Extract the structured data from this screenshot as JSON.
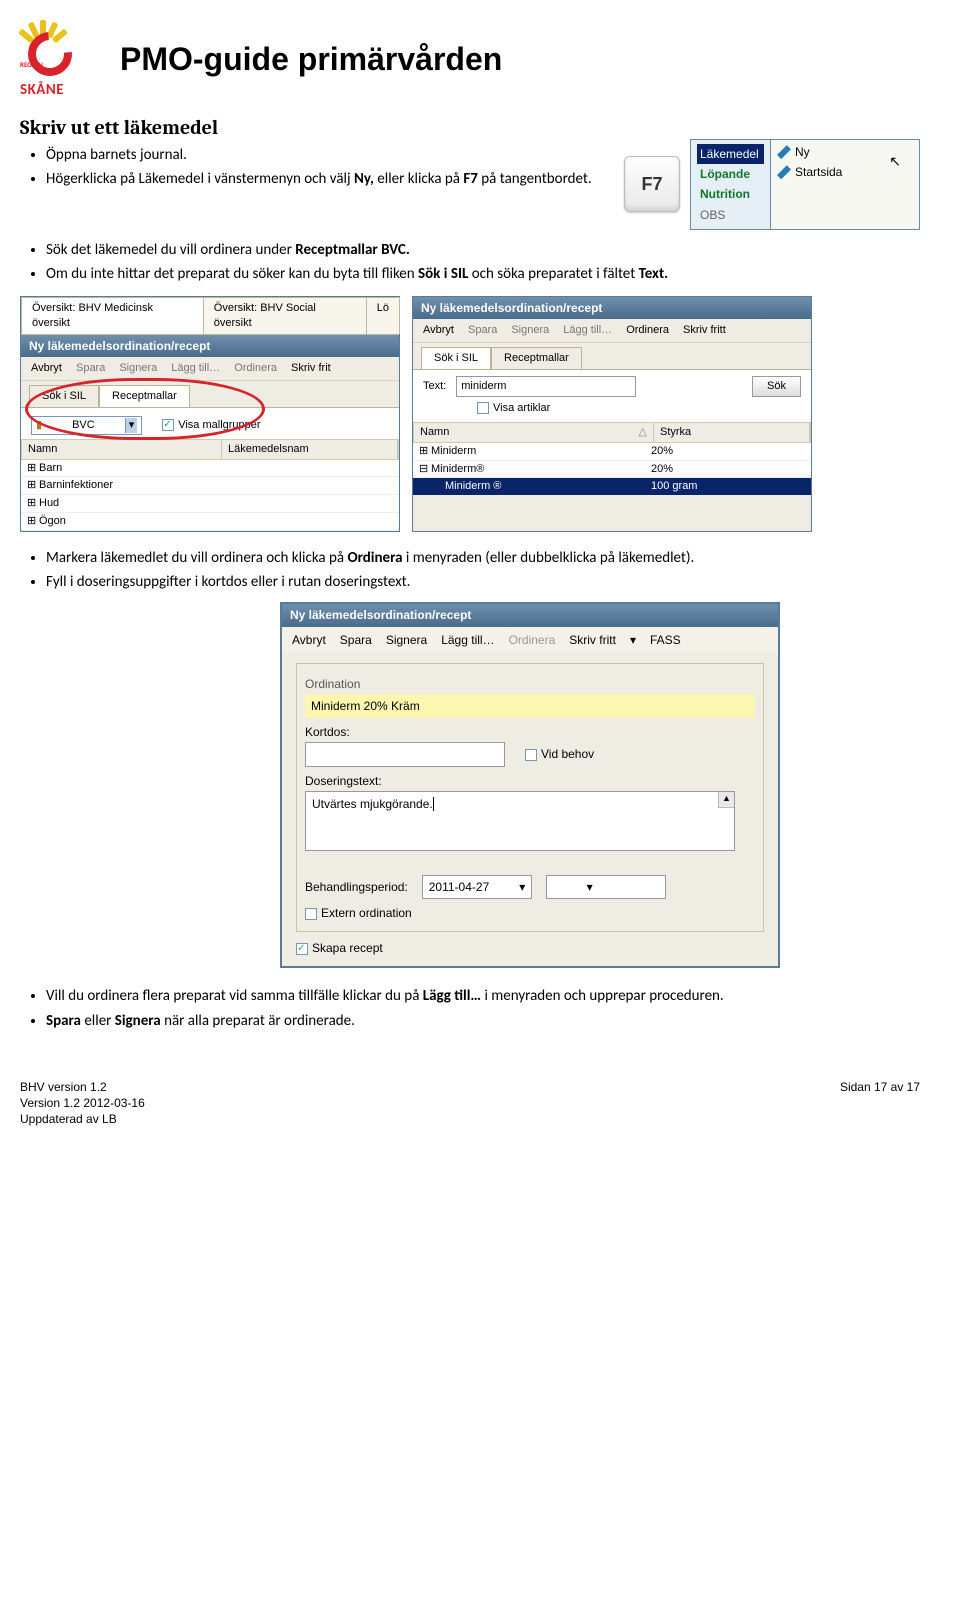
{
  "header": {
    "logo_region": "REGION",
    "logo_text": "SKÅNE",
    "page_title": "PMO-guide primärvården"
  },
  "section_title": "Skriv ut ett läkemedel",
  "bullets1": {
    "b1": "Öppna barnets journal.",
    "b2_a": "Högerklicka på Läkemedel i vänstermenyn och välj ",
    "b2_ny": "Ny, ",
    "b2_b": "eller klicka på ",
    "b2_f7": "F7",
    "b2_c": " på tangentbordet."
  },
  "context_menu": {
    "left": {
      "i1": "Läkemedel",
      "i2": "Löpande",
      "i3": "Nutrition",
      "i4": "OBS"
    },
    "right": {
      "r1": "Ny",
      "r2": "Startsida"
    }
  },
  "keycap": "F7",
  "bullets2": {
    "b1_a": "Sök det läkemedel du vill ordinera under ",
    "b1_b": "Receptmallar BVC.",
    "b2_a": "Om du inte hittar det preparat du söker kan du byta till fliken ",
    "b2_b": "Sök i SIL",
    "b2_c": " och söka preparatet i fältet ",
    "b2_d": "Text."
  },
  "shot1": {
    "tab1": "Översikt: BHV Medicinsk översikt",
    "tab2": "Översikt: BHV Social översikt",
    "tab3": "Lö",
    "bluetab": "Ny läkemedelsordination/recept",
    "tb": {
      "avbryt": "Avbryt",
      "spara": "Spara",
      "signera": "Signera",
      "lagg": "Lägg till…",
      "ordinera": "Ordinera",
      "skriv": "Skriv frit"
    },
    "sub": {
      "s1": "Sök i SIL",
      "s2": "Receptmallar"
    },
    "dropdown": {
      "icon": "folder",
      "val": "BVC"
    },
    "visa": "Visa mallgrupper",
    "cols": {
      "c1": "Namn",
      "c2": "Läkemedelsnam"
    },
    "rows": {
      "r1": "Barn",
      "r2": "Barninfektioner",
      "r3": "Hud",
      "r4": "Ögon"
    }
  },
  "shot2": {
    "title": "Ny läkemedelsordination/recept",
    "tb": {
      "avbryt": "Avbryt",
      "spara": "Spara",
      "signera": "Signera",
      "lagg": "Lägg till…",
      "ordinera": "Ordinera",
      "skriv": "Skriv fritt"
    },
    "sub": {
      "s1": "Sök i SIL",
      "s2": "Receptmallar"
    },
    "textlbl": "Text:",
    "textval": "miniderm",
    "sok": "Sök",
    "visa": "Visa artiklar",
    "cols": {
      "c1": "Namn",
      "c2": "Styrka"
    },
    "rows": {
      "r1n": "Miniderm",
      "r1s": "20%",
      "r2n": "Miniderm®",
      "r2s": "20%",
      "r3n": "Miniderm ®",
      "r3s": "100 gram"
    }
  },
  "bullets3": {
    "b1_a": "Markera läkemedlet du vill ordinera och klicka på ",
    "b1_b": "Ordinera",
    "b1_c": " i menyraden (eller dubbelklicka på läkemedlet).",
    "b2": "Fyll i doseringsuppgifter i kortdos eller i rutan doseringstext."
  },
  "shot3": {
    "title": "Ny läkemedelsordination/recept",
    "tb": {
      "avbryt": "Avbryt",
      "spara": "Spara",
      "signera": "Signera",
      "lagg": "Lägg till…",
      "ordinera": "Ordinera",
      "skriv": "Skriv fritt",
      "fass": "FASS"
    },
    "ord_section": "Ordination",
    "medname": "Miniderm 20% Kräm",
    "kortdos_lbl": "Kortdos:",
    "vidbehov": "Vid behov",
    "doser_lbl": "Doseringstext:",
    "doser_val": "Utvärtes mjukgörande.",
    "beh_lbl": "Behandlingsperiod:",
    "beh_date": "2011-04-27",
    "extern": "Extern ordination",
    "skapa": "Skapa recept"
  },
  "bullets4": {
    "b1_a": "Vill du ordinera flera preparat vid samma tillfälle klickar du på ",
    "b1_b": "Lägg till…",
    "b1_c": " i menyraden och upprepar proceduren.",
    "b2_a": "Spara",
    "b2_b": " eller ",
    "b2_c": "Signera",
    "b2_d": " när alla preparat är ordinerade."
  },
  "footer": {
    "l1": "BHV version 1.2",
    "l2": "Version 1.2 2012-03-16",
    "l3": "Uppdaterad av LB",
    "r": "Sidan 17 av 17"
  }
}
